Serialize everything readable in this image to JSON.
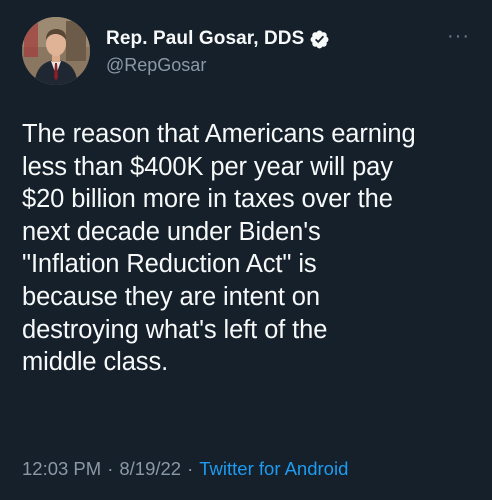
{
  "author": {
    "display_name": "Rep. Paul Gosar, DDS",
    "handle": "@RepGosar",
    "verified": true,
    "avatar_icon": "profile-photo"
  },
  "tweet": {
    "text": "The reason that Americans earning\nless than $400K per year will pay\n$20 billion more in taxes over the\nnext decade under Biden's\n\"Inflation Reduction Act\" is\nbecause they are intent on\ndestroying what's left of the\nmiddle class.",
    "time": "12:03 PM",
    "separator": "·",
    "date": "8/19/22",
    "source": "Twitter for Android"
  },
  "menu": {
    "more_label": "···"
  },
  "colors": {
    "background": "#15202b",
    "text": "#f7f9f9",
    "secondary": "#8b98a5",
    "link": "#1d9bf0"
  }
}
